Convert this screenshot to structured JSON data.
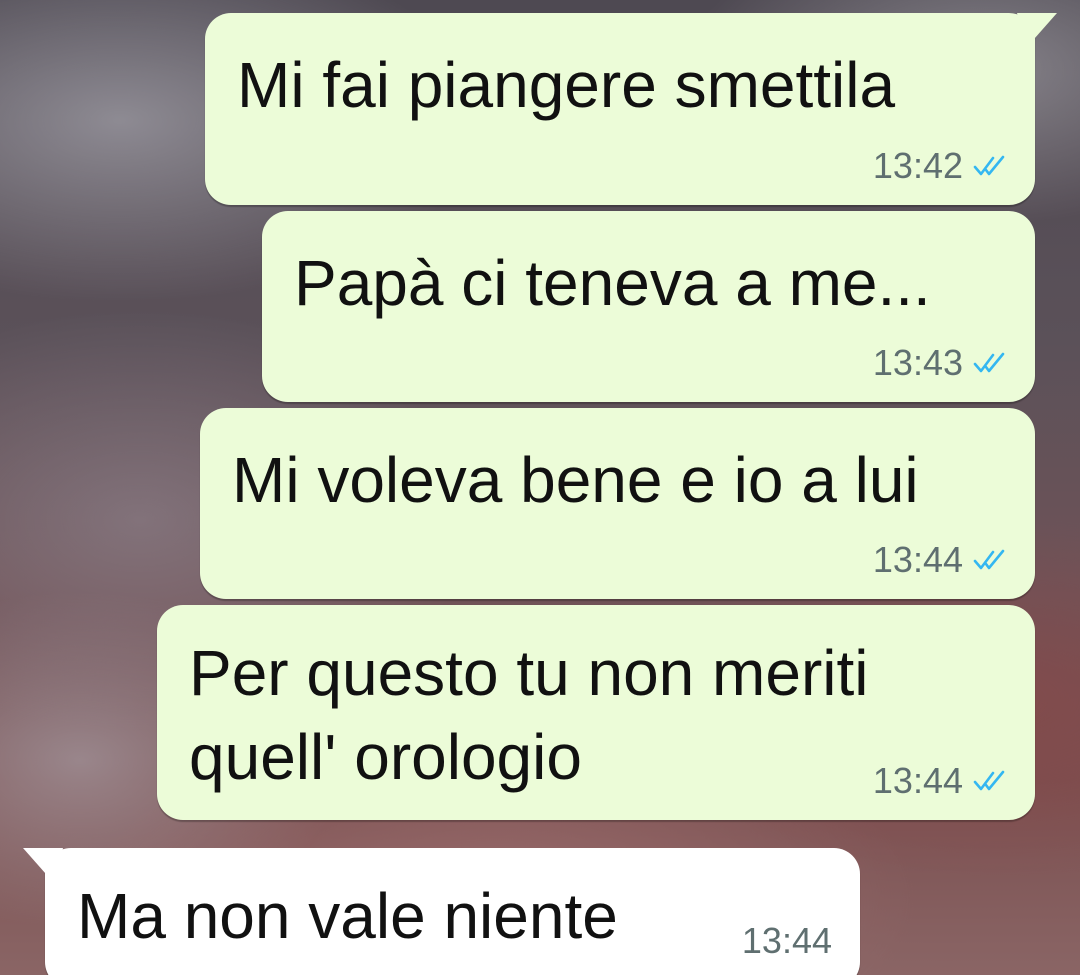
{
  "chat": {
    "messages": [
      {
        "text": "Mi fai piangere smettila",
        "time": "13:42",
        "direction": "outgoing",
        "status": "read"
      },
      {
        "text": "Papà ci teneva a me...",
        "time": "13:43",
        "direction": "outgoing",
        "status": "read"
      },
      {
        "text": "Mi voleva bene e io a lui",
        "time": "13:44",
        "direction": "outgoing",
        "status": "read"
      },
      {
        "text_line1": "Per questo tu non meriti",
        "text_line2": "quell' orologio",
        "time": "13:44",
        "direction": "outgoing",
        "status": "read"
      },
      {
        "text": "Ma non vale niente",
        "time": "13:44",
        "direction": "incoming"
      }
    ]
  },
  "colors": {
    "outgoing_bubble": "#ecfcd8",
    "incoming_bubble": "#ffffff",
    "read_ticks": "#34b7f1",
    "timestamp": "#5f6f70"
  },
  "icons": {
    "read_status": "double-check-icon"
  }
}
